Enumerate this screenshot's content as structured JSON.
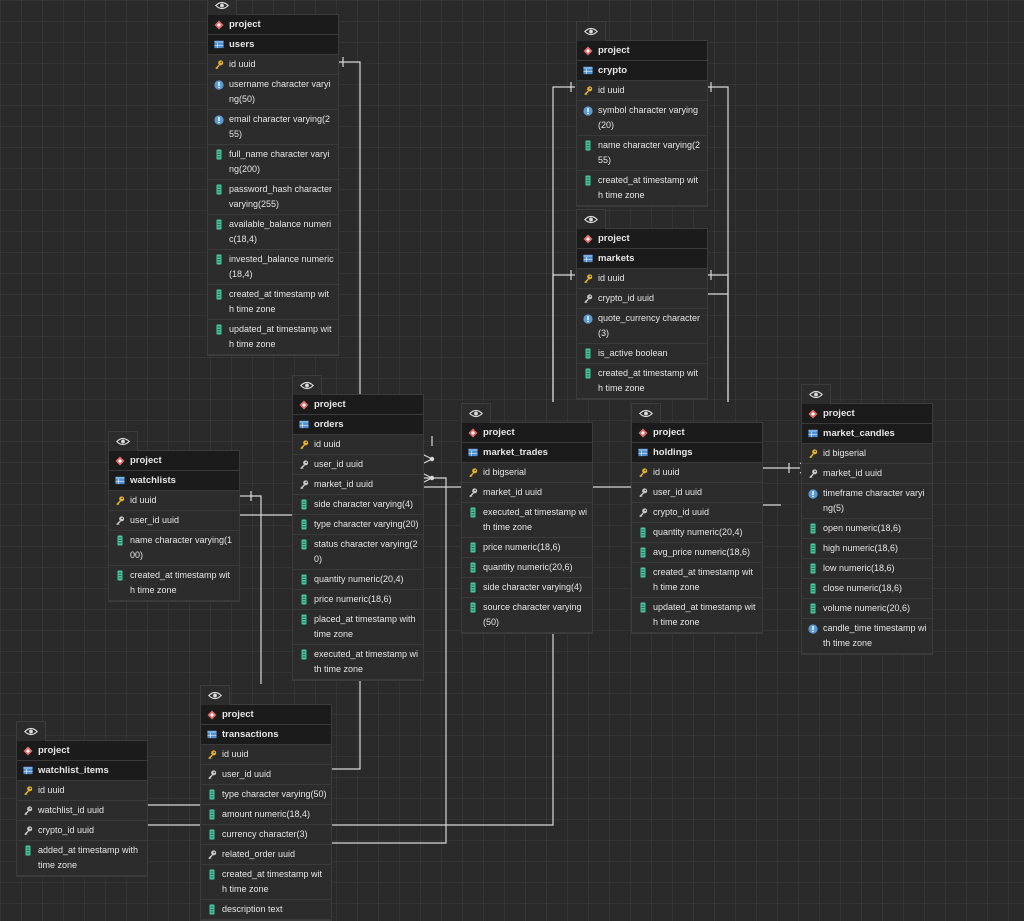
{
  "diagram": {
    "tables": [
      {
        "id": "users",
        "schema": "project",
        "name": "users",
        "columns": [
          {
            "text": "id uuid",
            "kind": "pk"
          },
          {
            "text": "username character varying(50)",
            "kind": "unique"
          },
          {
            "text": "email character varying(255)",
            "kind": "unique"
          },
          {
            "text": "full_name character varying(200)",
            "kind": "col"
          },
          {
            "text": "password_hash character varying(255)",
            "kind": "col"
          },
          {
            "text": "available_balance numeric(18,4)",
            "kind": "col"
          },
          {
            "text": "invested_balance numeric(18,4)",
            "kind": "col"
          },
          {
            "text": "created_at timestamp with time zone",
            "kind": "col"
          },
          {
            "text": "updated_at timestamp with time zone",
            "kind": "col"
          }
        ]
      },
      {
        "id": "crypto",
        "schema": "project",
        "name": "crypto",
        "columns": [
          {
            "text": "id uuid",
            "kind": "pk"
          },
          {
            "text": "symbol character varying(20)",
            "kind": "unique"
          },
          {
            "text": "name character varying(255)",
            "kind": "col"
          },
          {
            "text": "created_at timestamp with time zone",
            "kind": "col"
          }
        ]
      },
      {
        "id": "markets",
        "schema": "project",
        "name": "markets",
        "columns": [
          {
            "text": "id uuid",
            "kind": "pk"
          },
          {
            "text": "crypto_id uuid",
            "kind": "fk"
          },
          {
            "text": "quote_currency character(3)",
            "kind": "unique"
          },
          {
            "text": "is_active boolean",
            "kind": "col"
          },
          {
            "text": "created_at timestamp with time zone",
            "kind": "col"
          }
        ]
      },
      {
        "id": "orders",
        "schema": "project",
        "name": "orders",
        "columns": [
          {
            "text": "id uuid",
            "kind": "pk"
          },
          {
            "text": "user_id uuid",
            "kind": "fk"
          },
          {
            "text": "market_id uuid",
            "kind": "fk"
          },
          {
            "text": "side character varying(4)",
            "kind": "col"
          },
          {
            "text": "type character varying(20)",
            "kind": "col"
          },
          {
            "text": "status character varying(20)",
            "kind": "col"
          },
          {
            "text": "quantity numeric(20,4)",
            "kind": "col"
          },
          {
            "text": "price numeric(18,6)",
            "kind": "col"
          },
          {
            "text": "placed_at timestamp with time zone",
            "kind": "col"
          },
          {
            "text": "executed_at timestamp with time zone",
            "kind": "col"
          }
        ]
      },
      {
        "id": "market_trades",
        "schema": "project",
        "name": "market_trades",
        "columns": [
          {
            "text": "id bigserial",
            "kind": "pk"
          },
          {
            "text": "market_id uuid",
            "kind": "fk"
          },
          {
            "text": "executed_at timestamp with time zone",
            "kind": "col"
          },
          {
            "text": "price numeric(18,6)",
            "kind": "col"
          },
          {
            "text": "quantity numeric(20,6)",
            "kind": "col"
          },
          {
            "text": "side character varying(4)",
            "kind": "col"
          },
          {
            "text": "source character varying(50)",
            "kind": "col"
          }
        ]
      },
      {
        "id": "holdings",
        "schema": "project",
        "name": "holdings",
        "columns": [
          {
            "text": "id uuid",
            "kind": "pk"
          },
          {
            "text": "user_id uuid",
            "kind": "fk"
          },
          {
            "text": "crypto_id uuid",
            "kind": "fk"
          },
          {
            "text": "quantity numeric(20,4)",
            "kind": "col"
          },
          {
            "text": "avg_price numeric(18,6)",
            "kind": "col"
          },
          {
            "text": "created_at timestamp with time zone",
            "kind": "col"
          },
          {
            "text": "updated_at timestamp with time zone",
            "kind": "col"
          }
        ]
      },
      {
        "id": "market_candles",
        "schema": "project",
        "name": "market_candles",
        "columns": [
          {
            "text": "id bigserial",
            "kind": "pk"
          },
          {
            "text": "market_id uuid",
            "kind": "fk"
          },
          {
            "text": "timeframe character varying(5)",
            "kind": "unique"
          },
          {
            "text": "open numeric(18,6)",
            "kind": "col"
          },
          {
            "text": "high numeric(18,6)",
            "kind": "col"
          },
          {
            "text": "low numeric(18,6)",
            "kind": "col"
          },
          {
            "text": "close numeric(18,6)",
            "kind": "col"
          },
          {
            "text": "volume numeric(20,6)",
            "kind": "col"
          },
          {
            "text": "candle_time timestamp with time zone",
            "kind": "unique"
          }
        ]
      },
      {
        "id": "watchlists",
        "schema": "project",
        "name": "watchlists",
        "columns": [
          {
            "text": "id uuid",
            "kind": "pk"
          },
          {
            "text": "user_id uuid",
            "kind": "fk"
          },
          {
            "text": "name character varying(100)",
            "kind": "col"
          },
          {
            "text": "created_at timestamp with time zone",
            "kind": "col"
          }
        ]
      },
      {
        "id": "transactions",
        "schema": "project",
        "name": "transactions",
        "columns": [
          {
            "text": "id uuid",
            "kind": "pk"
          },
          {
            "text": "user_id uuid",
            "kind": "fk"
          },
          {
            "text": "type character varying(50)",
            "kind": "col"
          },
          {
            "text": "amount numeric(18,4)",
            "kind": "col"
          },
          {
            "text": "currency character(3)",
            "kind": "col"
          },
          {
            "text": "related_order uuid",
            "kind": "fk"
          },
          {
            "text": "created_at timestamp with time zone",
            "kind": "col"
          },
          {
            "text": "description text",
            "kind": "col"
          }
        ]
      },
      {
        "id": "watchlist_items",
        "schema": "project",
        "name": "watchlist_items",
        "columns": [
          {
            "text": "id uuid",
            "kind": "pk"
          },
          {
            "text": "watchlist_id uuid",
            "kind": "fk"
          },
          {
            "text": "crypto_id uuid",
            "kind": "fk"
          },
          {
            "text": "added_at timestamp with time zone",
            "kind": "col"
          }
        ]
      }
    ]
  }
}
